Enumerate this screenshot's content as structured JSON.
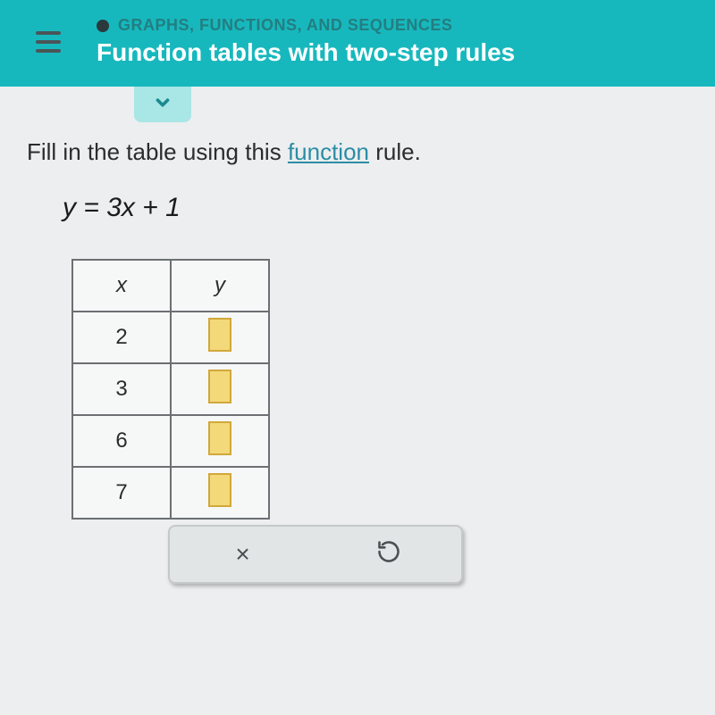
{
  "header": {
    "breadcrumb": "GRAPHS, FUNCTIONS, AND SEQUENCES",
    "title": "Function tables with two-step rules"
  },
  "instruction": {
    "prefix": "Fill in the table using this ",
    "link": "function",
    "suffix": " rule."
  },
  "equation": "y = 3x + 1",
  "table": {
    "headers": {
      "col1": "x",
      "col2": "y"
    },
    "rows": [
      {
        "x": "2",
        "y": ""
      },
      {
        "x": "3",
        "y": ""
      },
      {
        "x": "6",
        "y": ""
      },
      {
        "x": "7",
        "y": ""
      }
    ]
  },
  "toolbar": {
    "clear_symbol": "×"
  }
}
